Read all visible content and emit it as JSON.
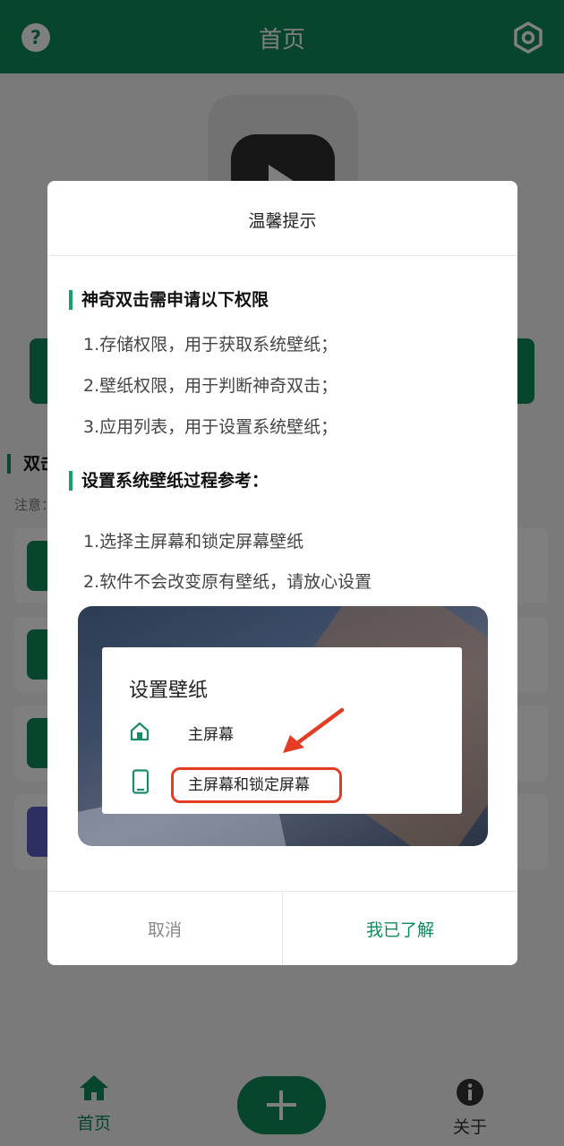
{
  "app": {
    "title": "首页",
    "section_label": "双击",
    "note_label": "注意：",
    "nav": {
      "home": "首页",
      "about": "关于"
    }
  },
  "dialog": {
    "title": "温馨提示",
    "permissions_heading": "神奇双击需申请以下权限",
    "permissions": [
      "1.存储权限，用于获取系统壁纸；",
      "2.壁纸权限，用于判断神奇双击；",
      "3.应用列表，用于设置系统壁纸；"
    ],
    "process_heading": "设置系统壁纸过程参考：",
    "steps": [
      "1.选择主屏幕和锁定屏幕壁纸",
      "2.软件不会改变原有壁纸，请放心设置"
    ],
    "illustration": {
      "title": "设置壁纸",
      "option_home": "主屏幕",
      "option_home_lock": "主屏幕和锁定屏幕"
    },
    "cancel": "取消",
    "confirm": "我已了解"
  },
  "colors": {
    "brand": "#0e8a5a",
    "highlight": "#e23c23"
  },
  "icons": [
    "help-icon",
    "settings-icon",
    "home-icon",
    "info-icon",
    "plus-icon",
    "phone-icon",
    "arrow-icon"
  ]
}
